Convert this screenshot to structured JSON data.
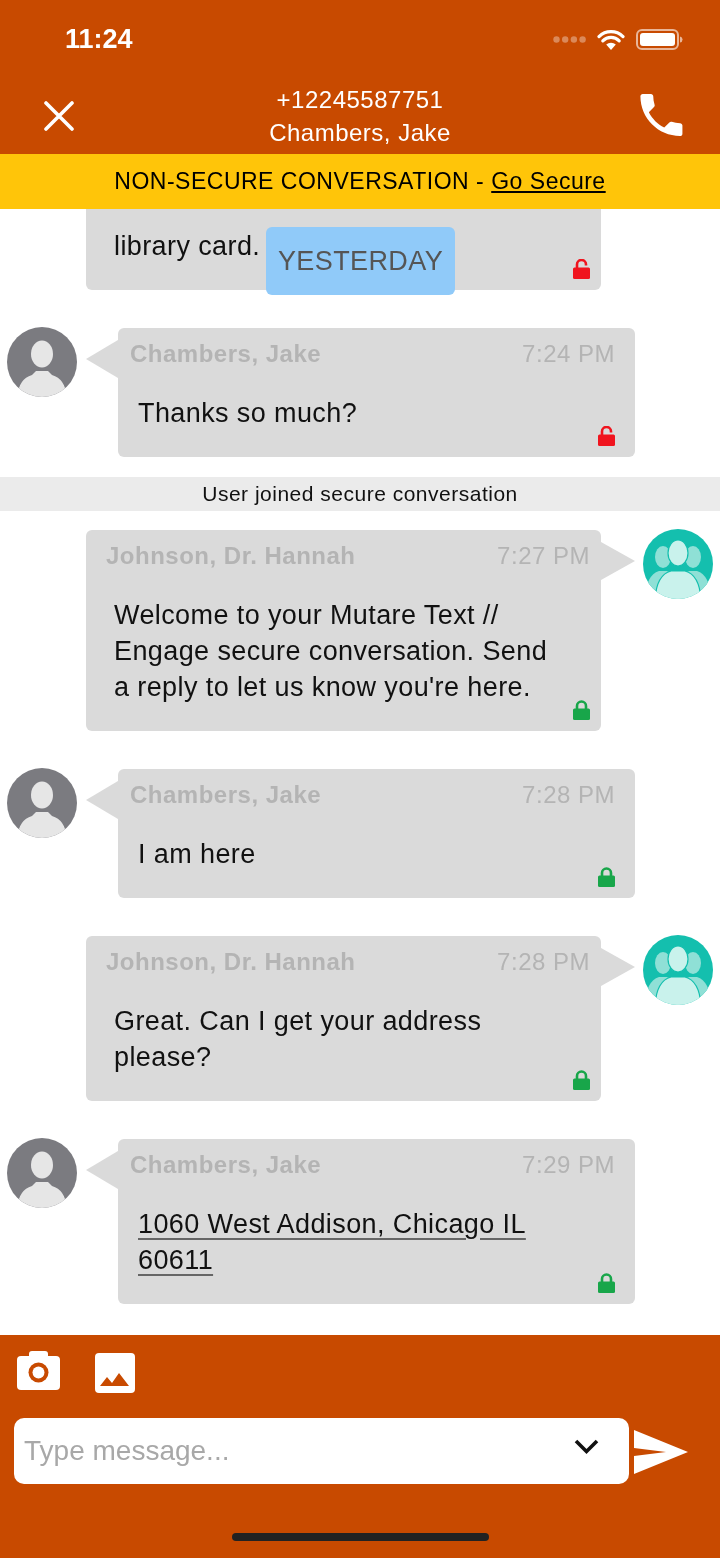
{
  "status_bar": {
    "time": "11:24"
  },
  "header": {
    "phone": "+12245587751",
    "contact": "Chambers, Jake"
  },
  "banner": {
    "text": "NON-SECURE CONVERSATION -",
    "link": "Go Secure"
  },
  "date_badge": {
    "label": "YESTERDAY"
  },
  "timeline": [
    {
      "kind": "sent",
      "text": "library card.",
      "secure": false,
      "link": false
    },
    {
      "kind": "received",
      "sender": "Chambers, Jake",
      "time": "7:24 PM",
      "text": "Thanks so much?",
      "secure": false,
      "link": false
    },
    {
      "kind": "notice",
      "text": "User joined secure conversation"
    },
    {
      "kind": "sent",
      "sender": "Johnson, Dr. Hannah",
      "time": "7:27 PM",
      "text": "Welcome to your Mutare Text // Engage secure conversation. Send a reply to let us know you're here.",
      "secure": true,
      "link": false
    },
    {
      "kind": "received",
      "sender": "Chambers, Jake",
      "time": "7:28 PM",
      "text": "I am here",
      "secure": true,
      "link": false
    },
    {
      "kind": "sent",
      "sender": "Johnson, Dr. Hannah",
      "time": "7:28 PM",
      "text": "Great. Can I get your address please?",
      "secure": true,
      "link": false
    },
    {
      "kind": "received",
      "sender": "Chambers, Jake",
      "time": "7:29 PM",
      "text": "1060 West Addison, Chicago IL 60611",
      "secure": true,
      "link": true
    }
  ],
  "composer": {
    "placeholder": "Type message..."
  }
}
